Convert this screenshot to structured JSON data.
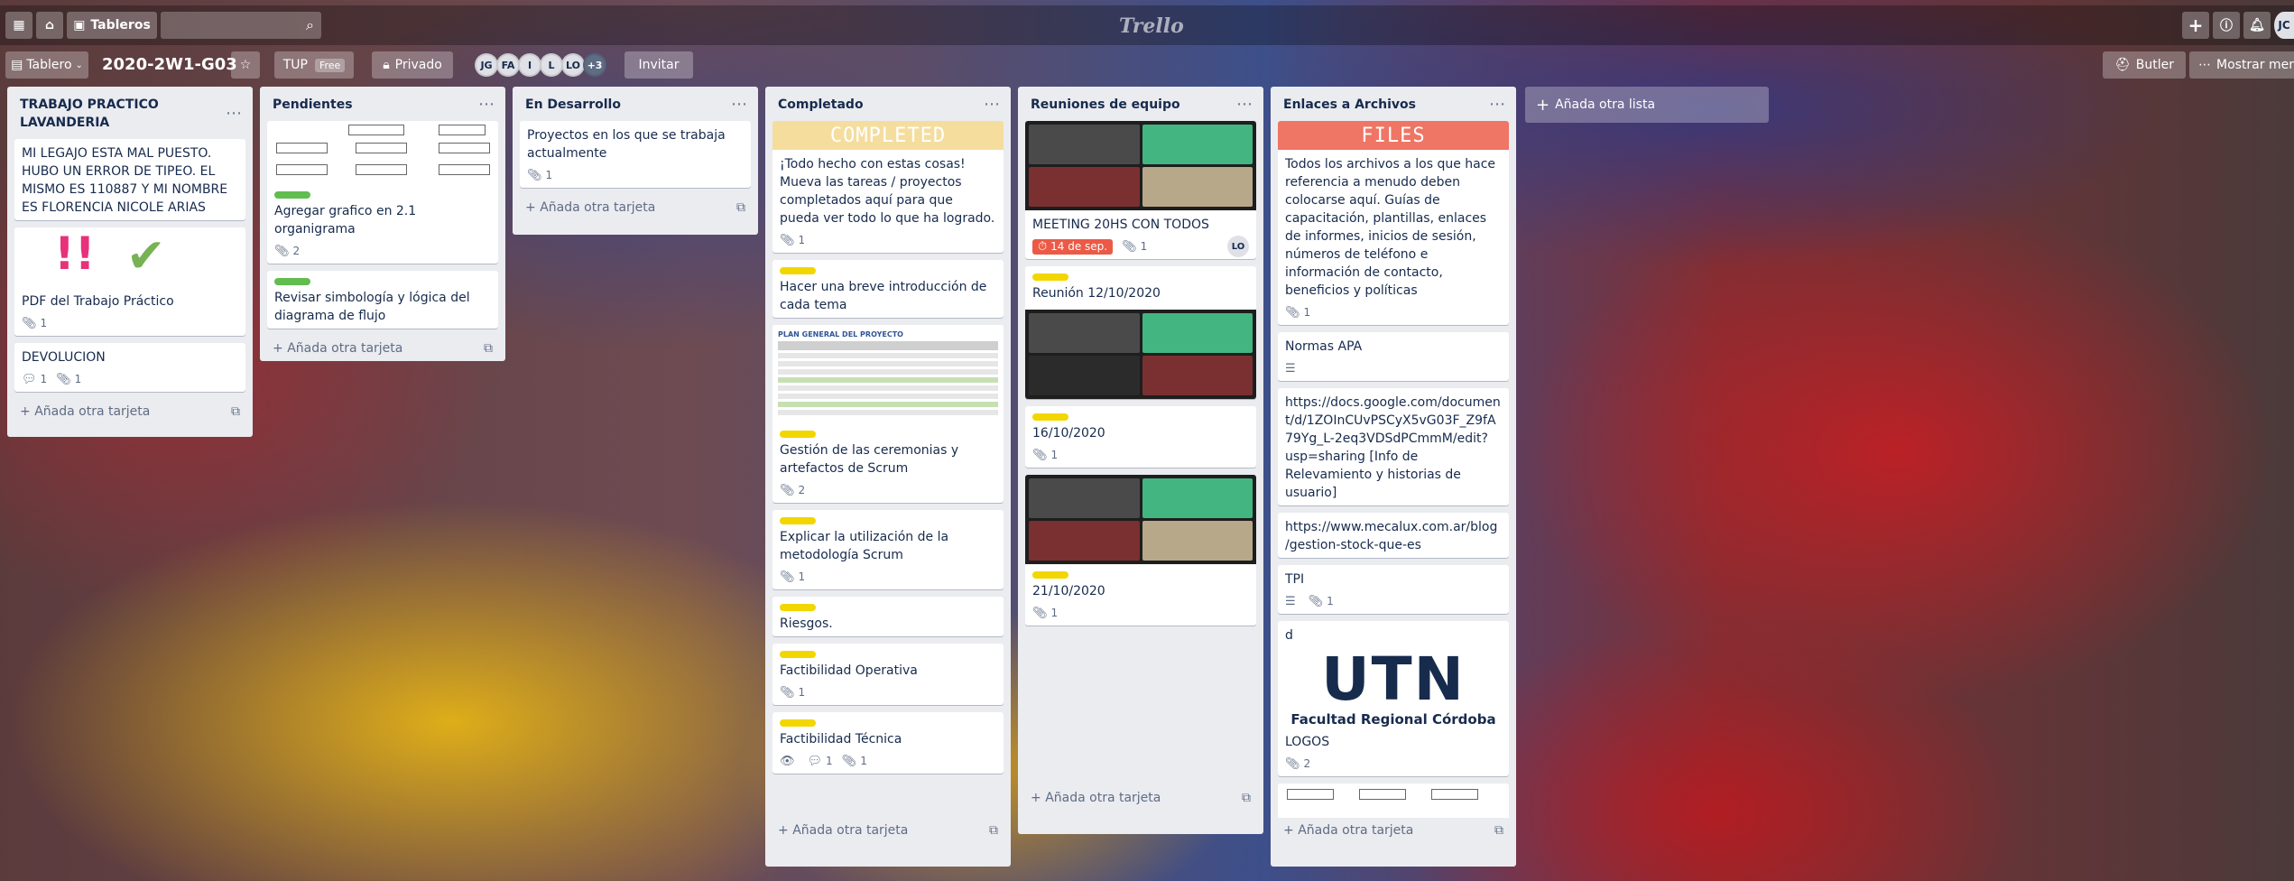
{
  "topbar": {
    "boards_label": "Tableros",
    "logo": "Trello",
    "right_avatar": "JC"
  },
  "boardbar": {
    "view_label": "Tablero",
    "board_title": "2020-2W1-G03",
    "team_label": "TUP",
    "team_plan": "Free",
    "privacy_label": "Privado",
    "members": [
      "JG",
      "FA",
      "I",
      "L",
      "LO"
    ],
    "members_more": "+3",
    "invite_label": "Invitar",
    "butler_label": "Butler",
    "show_menu_label": "Mostrar menú"
  },
  "add_card_label": "Añada otra tarjeta",
  "add_list_label": "Añada otra lista",
  "lists": [
    {
      "title": "TRABAJO PRACTICO LAVANDERIA",
      "cards": [
        {
          "title": "MI LEGAJO ESTA MAL PUESTO. HUBO UN ERROR DE TIPEO. EL MISMO ES 110887 Y MI NOMBRE ES FLORENCIA NICOLE ARIAS"
        },
        {
          "title": "PDF del Trabajo Práctico",
          "attachments": "1"
        },
        {
          "title": "DEVOLUCION",
          "comments": "1",
          "attachments": "1"
        }
      ]
    },
    {
      "title": "Pendientes",
      "cards": [
        {
          "title": "Agregar grafico en 2.1 organigrama",
          "attachments": "2"
        },
        {
          "title": "Revisar simbología y lógica del diagrama de flujo"
        }
      ]
    },
    {
      "title": "En Desarrollo",
      "cards": [
        {
          "title": "Proyectos en los que se trabaja actualmente",
          "attachments": "1"
        }
      ]
    },
    {
      "title": "Completado",
      "cover_text": "COMPLETED",
      "cards": [
        {
          "title": "¡Todo hecho con estas cosas! Mueva las tareas / proyectos completados aquí para que pueda ver todo lo que ha logrado.",
          "attachments": "1"
        },
        {
          "title": "Hacer una breve introducción de cada tema"
        },
        {
          "title": "Gestión de las ceremonias y artefactos de Scrum",
          "attachments": "2",
          "sheet_title": "PLAN GENERAL DEL PROYECTO"
        },
        {
          "title": "Explicar la utilización de la metodología Scrum",
          "attachments": "1"
        },
        {
          "title": "Riesgos."
        },
        {
          "title": "Factibilidad Operativa",
          "attachments": "1"
        },
        {
          "title": "Factibilidad Técnica",
          "comments": "1",
          "attachments": "1"
        }
      ]
    },
    {
      "title": "Reuniones de equipo",
      "cards": [
        {
          "title": "MEETING 20HS CON TODOS",
          "due": "14 de sep.",
          "attachments": "1",
          "member": "LO"
        },
        {
          "title": "Reunión 12/10/2020"
        },
        {
          "title": "16/10/2020",
          "attachments": "1"
        },
        {
          "title": "21/10/2020",
          "attachments": "1"
        }
      ]
    },
    {
      "title": "Enlaces a Archivos",
      "cover_text": "FILES",
      "cards": [
        {
          "title": "Todos los archivos a los que hace referencia a menudo deben colocarse aquí. Guías de capacitación, plantillas, enlaces de informes, inicios de sesión, números de teléfono e información de contacto, beneficios y políticas",
          "attachments": "1"
        },
        {
          "title": "Normas APA"
        },
        {
          "title": "https://docs.google.com/document/d/1ZOInCUvPSCyX5vG03F_Z9fA79Yg_L-2eq3VDSdPCmmM/edit?usp=sharing [Info de Relevamiento y historias de usuario]"
        },
        {
          "title": "https://www.mecalux.com.ar/blog/gestion-stock-que-es"
        },
        {
          "title": "TPI",
          "attachments": "1"
        },
        {
          "title": "d"
        },
        {
          "title": "LOGOS",
          "attachments": "2",
          "logo_main": "UTN",
          "logo_sub": "Facultad Regional Córdoba"
        }
      ]
    }
  ],
  "colors": {
    "label_green": "#61bd4f",
    "label_yellow": "#f2d600",
    "due_red": "#eb5a46",
    "completed_cover": "#f5dd9e",
    "files_cover": "#ef7564"
  }
}
